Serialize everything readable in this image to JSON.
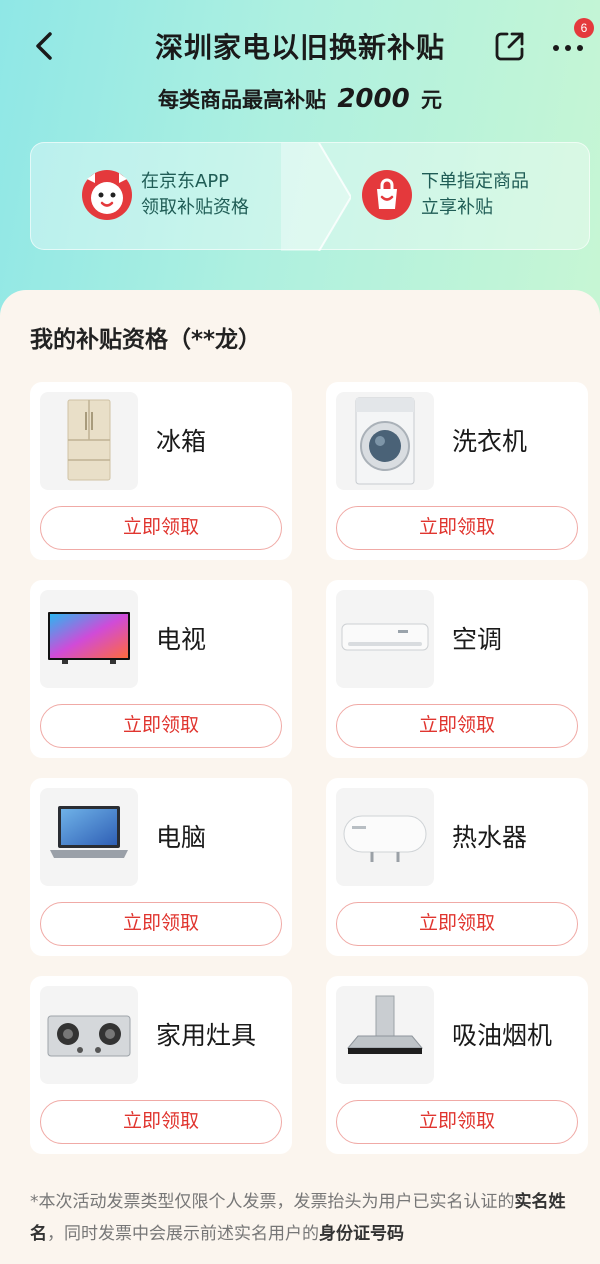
{
  "header": {
    "title": "深圳家电以旧换新补贴",
    "badge_count": "6"
  },
  "subtitle": {
    "prefix": "每类商品最高补贴",
    "amount": "2000",
    "suffix": "元"
  },
  "steps": [
    {
      "line1": "在京东APP",
      "line2": "领取补贴资格"
    },
    {
      "line1": "下单指定商品",
      "line2": "立享补贴"
    }
  ],
  "eligibility": {
    "title": "我的补贴资格（**龙）",
    "claim_label": "立即领取",
    "items": [
      {
        "name": "冰箱",
        "icon": "refrigerator"
      },
      {
        "name": "洗衣机",
        "icon": "washing-machine"
      },
      {
        "name": "电视",
        "icon": "television"
      },
      {
        "name": "空调",
        "icon": "air-conditioner"
      },
      {
        "name": "电脑",
        "icon": "laptop"
      },
      {
        "name": "热水器",
        "icon": "water-heater"
      },
      {
        "name": "家用灶具",
        "icon": "gas-stove"
      },
      {
        "name": "吸油烟机",
        "icon": "range-hood"
      }
    ]
  },
  "footnote": {
    "part1": "*本次活动发票类型仅限个人发票，发票抬头为用户已实名认证的",
    "bold1": "实名姓名",
    "part2": "，同时发票中会展示前述实名用户的",
    "bold2": "身份证号码"
  },
  "colors": {
    "accent_red": "#e0352f",
    "header_gradient_start": "#8fe7e6",
    "header_gradient_end": "#c7f6d4"
  }
}
